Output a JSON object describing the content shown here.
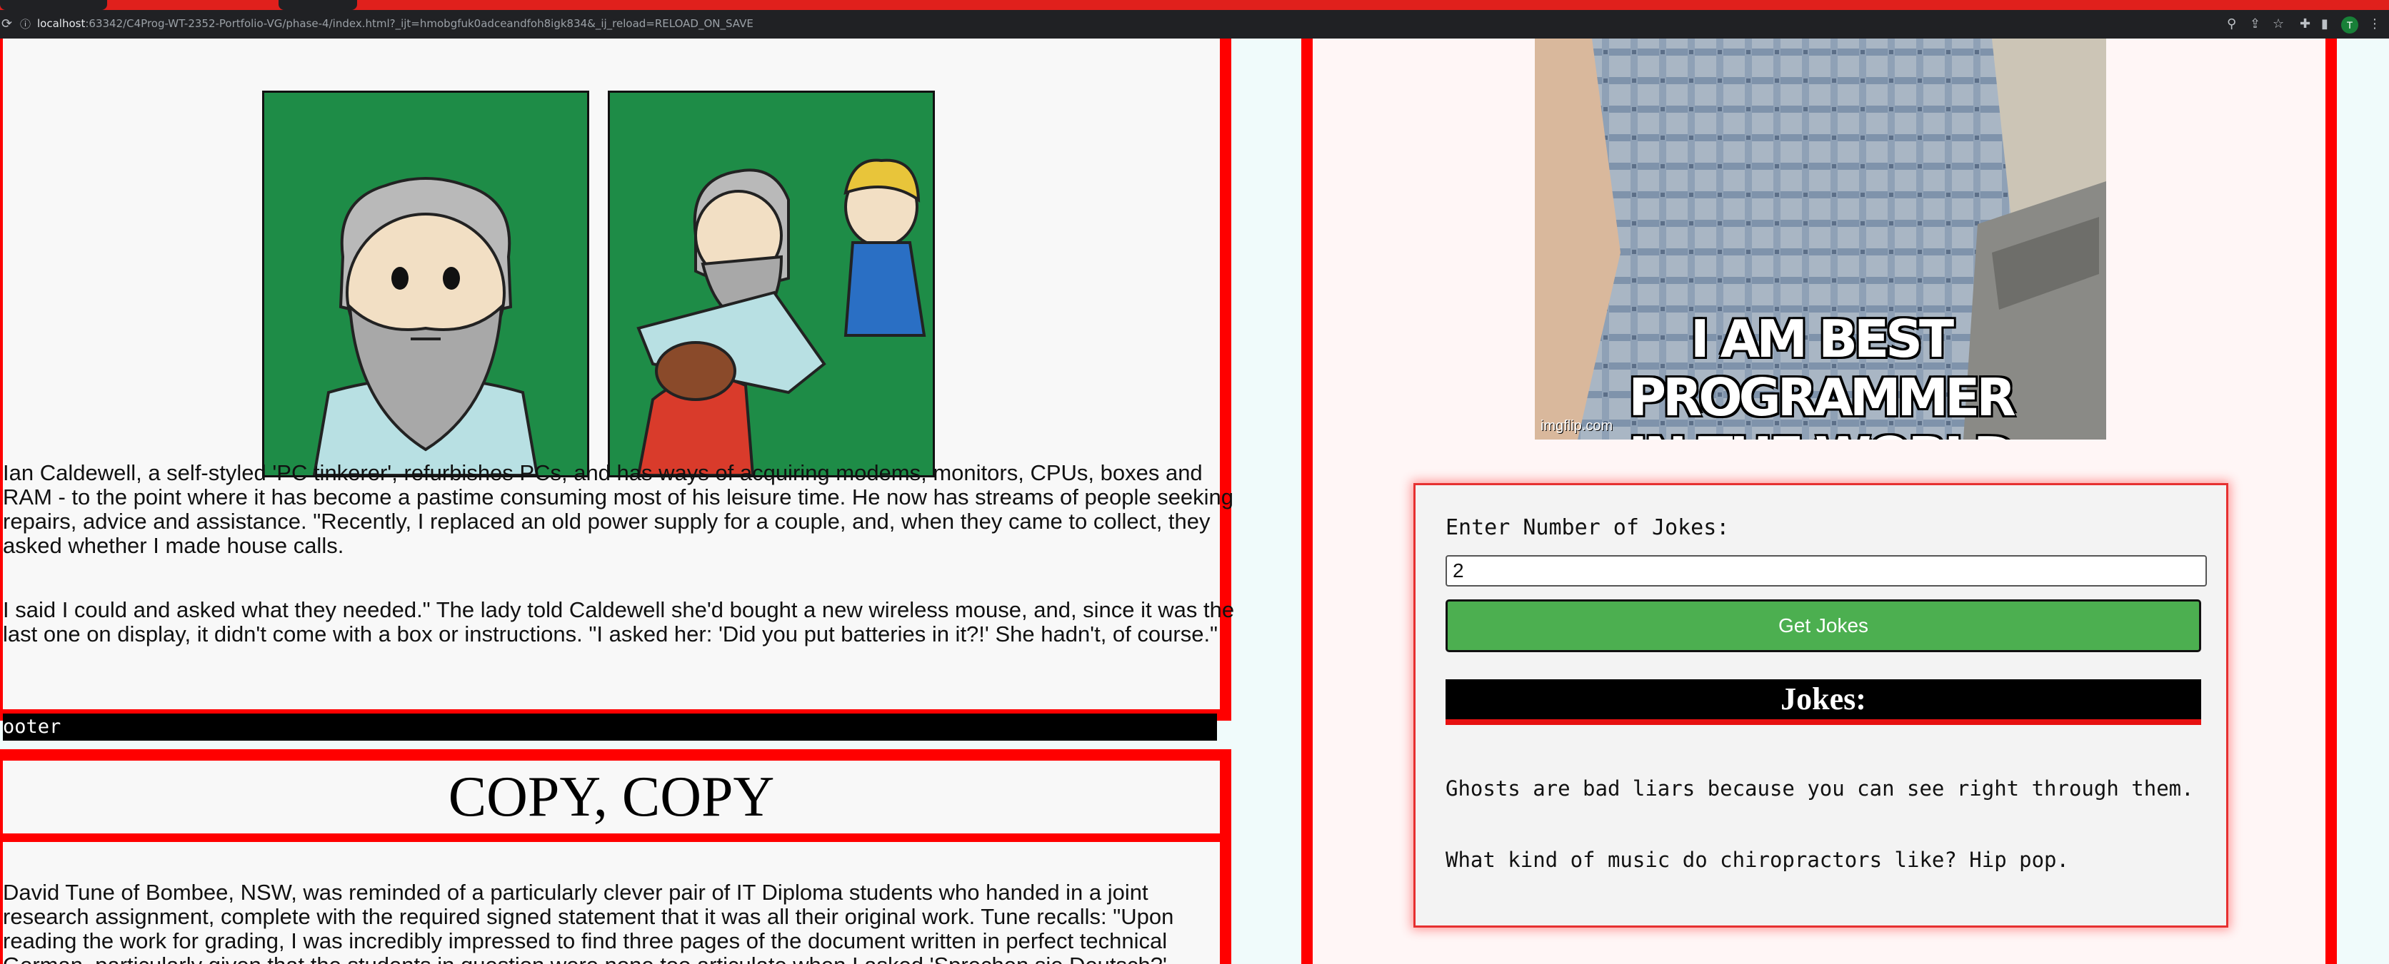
{
  "browser": {
    "url_host": "localhost",
    "url_rest": ":63342/C4Prog-WT-2352-Portfolio-VG/phase-4/index.html?_ijt=hmobgfuk0adceandfoh8igk834&_ij_reload=RELOAD_ON_SAVE",
    "profile_initial": "T"
  },
  "story": {
    "paragraph1_lines": [
      "Ian Caldewell, a self-styled 'PC tinkerer', refurbishes PCs, and has ways of acquiring modems, monitors, CPUs, boxes and",
      "RAM - to the point where it has become a pastime consuming most of his leisure time. He now has streams of people seeking",
      "repairs, advice and assistance. \"Recently, I replaced an old power supply for a couple, and, when they came to collect, they",
      "asked whether I made house calls."
    ],
    "paragraph2_lines": [
      "I said I could and asked what they needed.\" The lady told Caldewell she'd bought a new wireless mouse, and, since it was the",
      "last one on display, it didn't come with a box or instructions. \"I asked her: 'Did you put batteries in it?!' She hadn't, of course.\""
    ],
    "footer_label": "ooter"
  },
  "copy_section": {
    "title": "COPY, COPY",
    "paragraph_lines": [
      "David Tune of Bombee, NSW, was reminded of a particularly clever pair of IT Diploma students who handed in a joint",
      "research assignment, complete with the required signed statement that it was all their original work. Tune recalls: \"Upon",
      "reading the work for grading, I was incredibly impressed to find three pages of the document written in perfect technical",
      "German, particularly given that the students in question were none too articulate when I asked 'Sprechen sie Deutsch?'"
    ]
  },
  "meme": {
    "caption_line1": "I AM BEST PROGRAMMER",
    "caption_line2": "IN THE WORLD",
    "watermark": "imgflip.com"
  },
  "jokes_form": {
    "label": "Enter Number of Jokes:",
    "input_value": "2",
    "button_label": "Get Jokes",
    "heading": "Jokes:",
    "jokes": [
      "Ghosts are bad liars because you can see right through them.",
      "What kind of music do chiropractors like? Hip pop."
    ]
  },
  "colors": {
    "accent_red": "#ff0000",
    "button_green": "#4caf50",
    "comic_green": "#1e8c47"
  }
}
